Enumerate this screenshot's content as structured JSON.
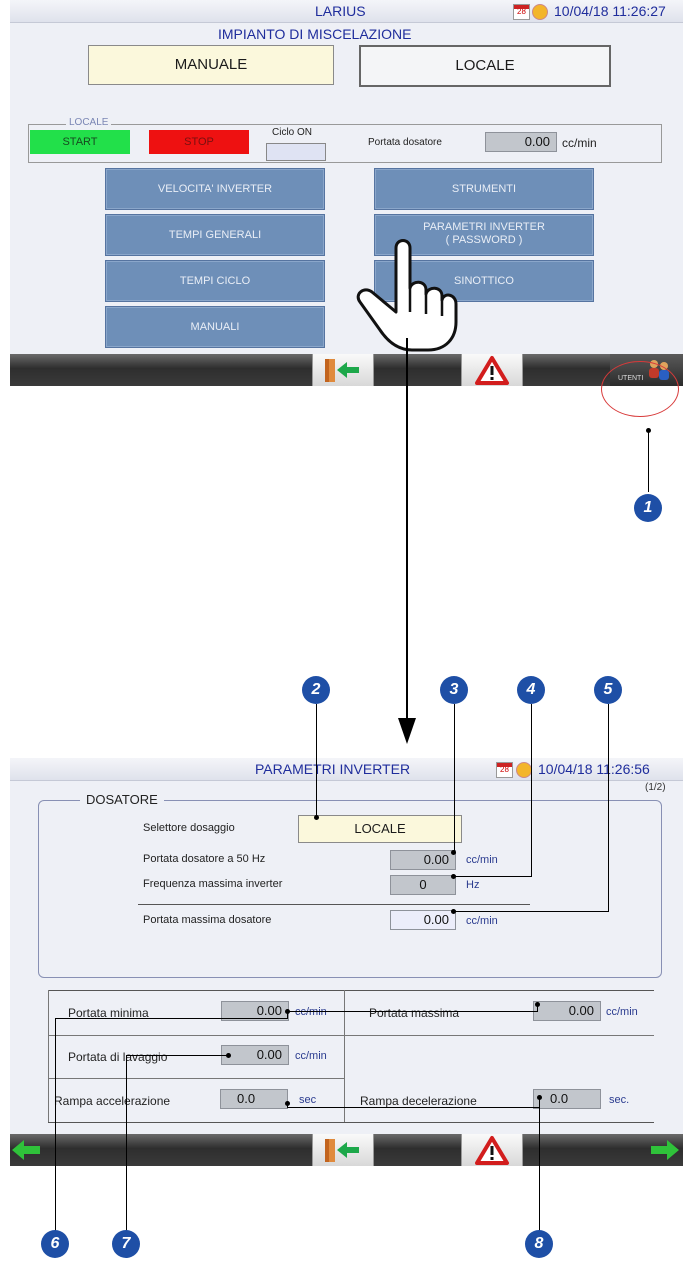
{
  "screen1": {
    "title": "LARIUS",
    "calendar_day": "28",
    "datetime": "10/04/18 11:26:27",
    "subtitle": "IMPIANTO DI MISCELAZIONE",
    "mode_button": "MANUALE",
    "source_button": "LOCALE",
    "group_label": "LOCALE",
    "start_label": "START",
    "stop_label": "STOP",
    "ciclo_label": "Ciclo ON",
    "portata_label": "Portata dosatore",
    "portata_value": "0.00",
    "portata_unit": "cc/min",
    "menu_left": [
      "VELOCITA' INVERTER",
      "TEMPI GENERALI",
      "TEMPI CICLO",
      "MANUALI"
    ],
    "menu_right_1": "STRUMENTI",
    "menu_right_2a": "PARAMETRI INVERTER",
    "menu_right_2b": "( PASSWORD )",
    "menu_right_3": "SINOTTICO",
    "users_label": "UTENTI"
  },
  "screen2": {
    "title": "PARAMETRI INVERTER",
    "calendar_day": "28",
    "datetime": "10/04/18 11:26:56",
    "page_indicator": "(1/2)",
    "group_title": "DOSATORE",
    "selettore_label": "Selettore dosaggio",
    "selettore_value": "LOCALE",
    "portata50_label": "Portata dosatore a 50 Hz",
    "portata50_value": "0.00",
    "portata50_unit": "cc/min",
    "freq_label": "Frequenza massima inverter",
    "freq_value": "0",
    "freq_unit": "Hz",
    "portatamax_dos_label": "Portata massima dosatore",
    "portatamax_dos_value": "0.00",
    "portatamax_dos_unit": "cc/min",
    "portata_minima_label": "Portata minima",
    "portata_minima_value": "0.00",
    "portata_minima_unit": "cc/min",
    "portata_massima_label": "Portata massima",
    "portata_massima_value": "0.00",
    "portata_massima_unit": "cc/min",
    "lavaggio_label": "Portata di lavaggio",
    "lavaggio_value": "0.00",
    "lavaggio_unit": "cc/min",
    "rampa_acc_label": "Rampa accelerazione",
    "rampa_acc_value": "0.0",
    "rampa_acc_unit": "sec",
    "rampa_dec_label": "Rampa decelerazione",
    "rampa_dec_value": "0.0",
    "rampa_dec_unit": "sec."
  },
  "callouts": [
    "1",
    "2",
    "3",
    "4",
    "5",
    "6",
    "7",
    "8"
  ],
  "colors": {
    "title_blue": "#1f2d9c",
    "start_green": "#22e04a",
    "stop_red": "#ee1111",
    "menu_blue": "#6e8fb8",
    "callout_blue": "#1e4fa6"
  }
}
